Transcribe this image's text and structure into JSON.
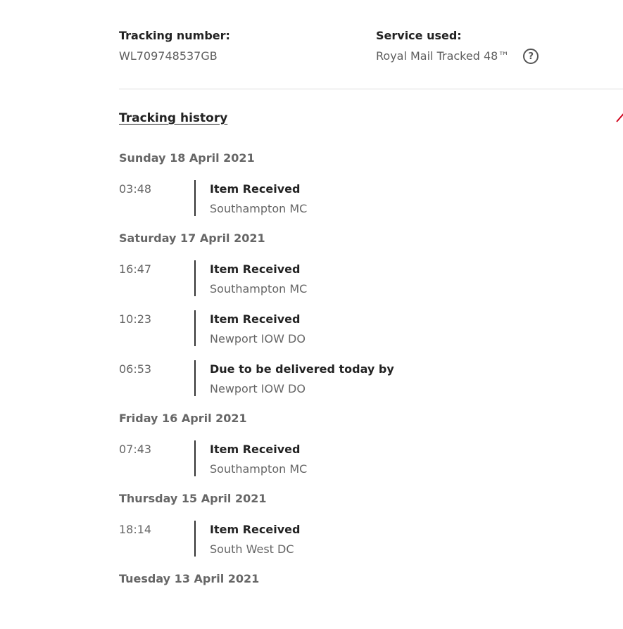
{
  "summary": {
    "tracking_label": "Tracking number:",
    "tracking_value": "WL709748537GB",
    "service_label": "Service used:",
    "service_value": "Royal Mail Tracked 48™",
    "help_icon": "question-circle-icon",
    "help_glyph": "?"
  },
  "history": {
    "heading": "Tracking history",
    "days": [
      {
        "date": "Sunday 18 April 2021",
        "events": [
          {
            "time": "03:48",
            "title": "Item Received",
            "location": "Southampton MC"
          }
        ]
      },
      {
        "date": "Saturday 17 April 2021",
        "events": [
          {
            "time": "16:47",
            "title": "Item Received",
            "location": "Southampton MC"
          },
          {
            "time": "10:23",
            "title": "Item Received",
            "location": "Newport IOW DO"
          },
          {
            "time": "06:53",
            "title": "Due to be delivered today by",
            "location": "Newport IOW DO"
          }
        ]
      },
      {
        "date": "Friday 16 April 2021",
        "events": [
          {
            "time": "07:43",
            "title": "Item Received",
            "location": "Southampton MC"
          }
        ]
      },
      {
        "date": "Thursday 15 April 2021",
        "events": [
          {
            "time": "18:14",
            "title": "Item Received",
            "location": "South West DC"
          }
        ]
      },
      {
        "date": "Tuesday 13 April 2021",
        "events": []
      }
    ]
  },
  "colors": {
    "accent": "#d0021b",
    "text_dark": "#222222",
    "text_muted": "#666666"
  }
}
